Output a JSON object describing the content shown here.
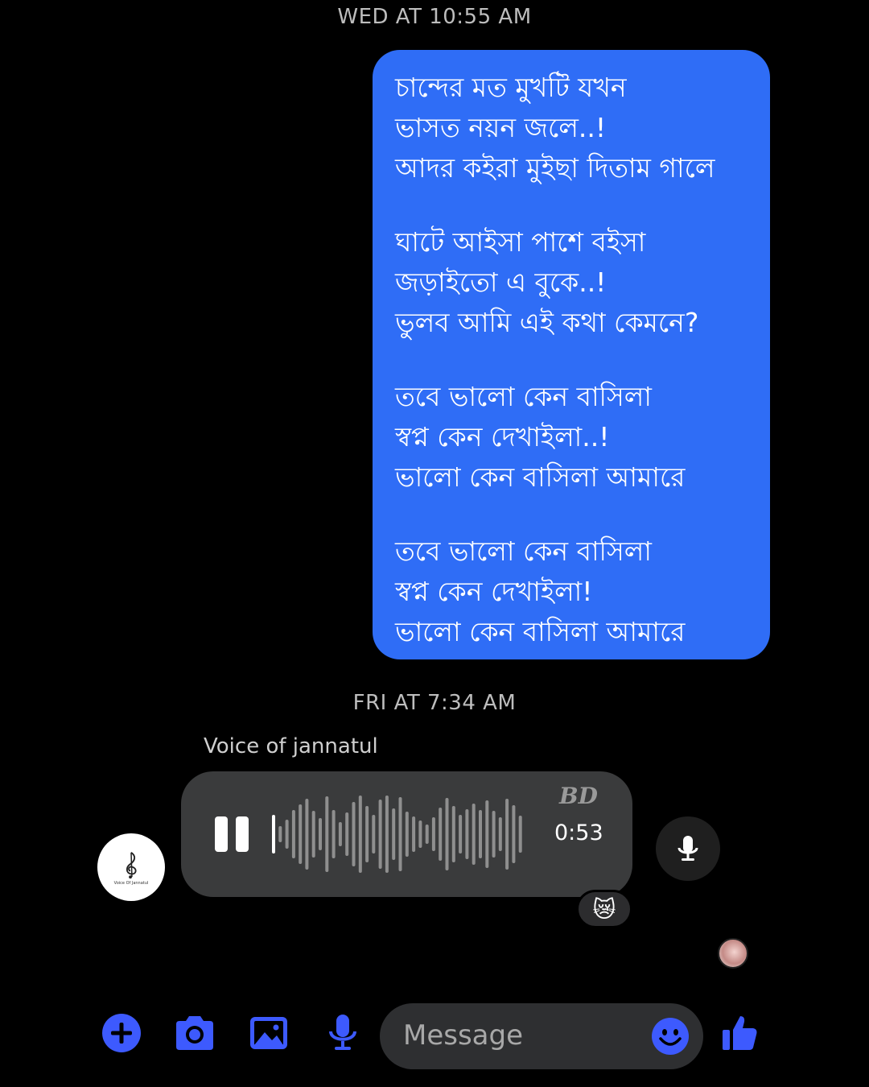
{
  "timestamps": {
    "first": "WED AT 10:55 AM",
    "second": "FRI AT 7:34 AM"
  },
  "sent_message": {
    "stanzas": [
      [
        "চান্দের মত মুখটি যখন",
        "ভাসত নয়ন জলে..!",
        "আদর কইরা মুইছা দিতাম গালে"
      ],
      [
        "ঘাটে আইসা পাশে বইসা",
        "জড়াইতো এ বুকে..!",
        "ভুলব আমি এই কথা কেমনে?"
      ],
      [
        "তবে ভালো কেন বাসিলা",
        "স্বপ্ন কেন দেখাইলা..!",
        "ভালো কেন বাসিলা আমারে"
      ],
      [
        "তবে ভালো কেন বাসিলা",
        "স্বপ্ন কেন দেখাইলা!",
        "ভালো কেন বাসিলা আমারে"
      ]
    ],
    "bubble_color": "#2f6df6"
  },
  "received_voice": {
    "sender_name": "Voice of jannatul",
    "watermark": "BD",
    "duration": "0:53",
    "state": "playing",
    "reaction": "😿",
    "avatar_caption": "Voice Of Jannatul"
  },
  "composer": {
    "placeholder": "Message",
    "accent_color": "#3d5afe",
    "icons": [
      "plus-icon",
      "camera-icon",
      "gallery-icon",
      "microphone-icon",
      "emoji-icon",
      "thumbs-up-icon"
    ]
  }
}
